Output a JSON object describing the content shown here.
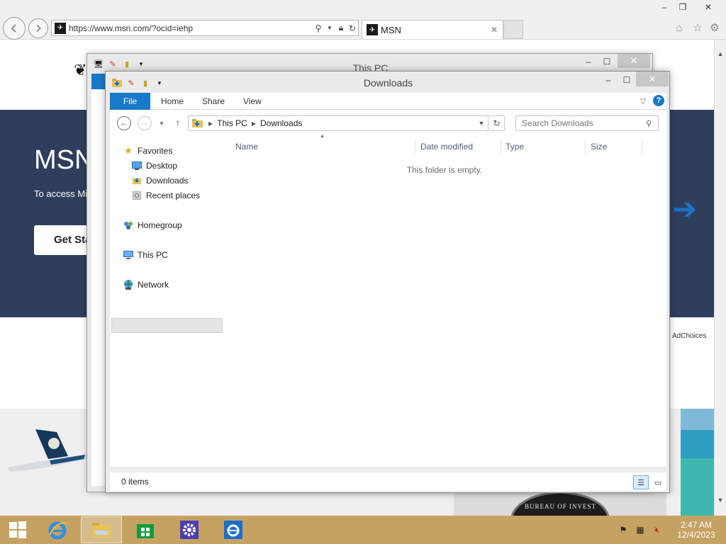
{
  "browser": {
    "url": "https://www.msn.com/?ocid=iehp",
    "tab_title": "MSN",
    "window_buttons": {
      "minimize": "–",
      "restore": "❐",
      "close": "✕"
    }
  },
  "msn": {
    "title": "MSN",
    "subtitle": "To access Mi",
    "button": "Get Sta",
    "ad_choices": "AdChoices",
    "seal_text": "BUREAU OF INVEST"
  },
  "thispc_window": {
    "title": "This PC"
  },
  "downloads_window": {
    "title": "Downloads",
    "ribbon_tabs": [
      "File",
      "Home",
      "Share",
      "View"
    ],
    "breadcrumb": [
      "This PC",
      "Downloads"
    ],
    "search_placeholder": "Search Downloads",
    "nav_pane": {
      "favorites": "Favorites",
      "favorites_items": [
        "Desktop",
        "Downloads",
        "Recent places"
      ],
      "homegroup": "Homegroup",
      "this_pc": "This PC",
      "network": "Network"
    },
    "columns": [
      "Name",
      "Date modified",
      "Type",
      "Size"
    ],
    "empty_message": "This folder is empty.",
    "status": "0 items"
  },
  "taskbar": {
    "time": "2:47 AM",
    "date": "12/4/2023"
  },
  "colors": {
    "ribbon_blue": "#1979ca",
    "taskbar": "#c6a262",
    "msn_hero": "#2f3e5c"
  }
}
